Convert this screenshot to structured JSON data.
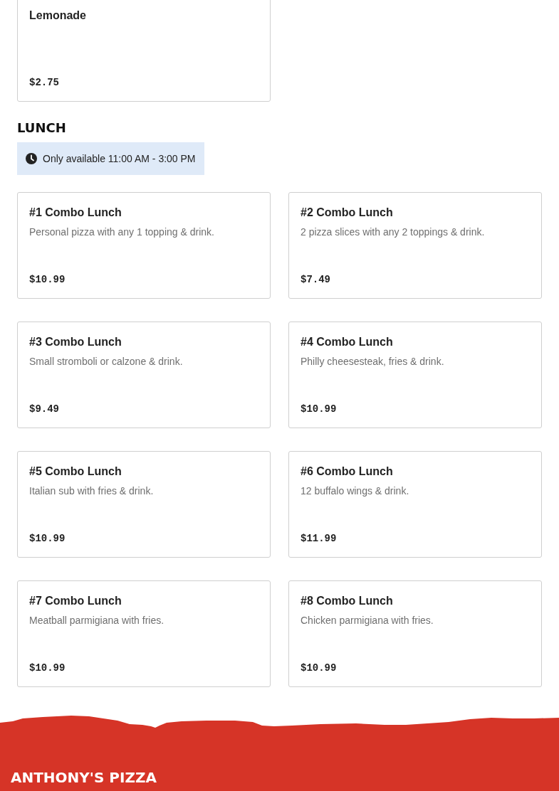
{
  "previous_section": {
    "items": [
      {
        "name": "Lemonade",
        "price": "$2.75"
      }
    ]
  },
  "section": {
    "title": "LUNCH",
    "availability": "Only available 11:00 AM - 3:00 PM",
    "items": [
      {
        "name": "#1 Combo Lunch",
        "description": "Personal pizza with any 1 topping & drink.",
        "price": "$10.99"
      },
      {
        "name": "#2 Combo Lunch",
        "description": "2 pizza slices with any 2 toppings & drink.",
        "price": "$7.49"
      },
      {
        "name": "#3 Combo Lunch",
        "description": "Small stromboli or calzone & drink.",
        "price": "$9.49"
      },
      {
        "name": "#4 Combo Lunch",
        "description": "Philly cheesesteak, fries & drink.",
        "price": "$10.99"
      },
      {
        "name": "#5 Combo Lunch",
        "description": "Italian sub with fries & drink.",
        "price": "$10.99"
      },
      {
        "name": "#6 Combo Lunch",
        "description": "12 buffalo wings & drink.",
        "price": "$11.99"
      },
      {
        "name": "#7 Combo Lunch",
        "description": "Meatball parmigiana with fries.",
        "price": "$10.99"
      },
      {
        "name": "#8 Combo Lunch",
        "description": "Chicken parmigiana with fries.",
        "price": "$10.99"
      }
    ]
  },
  "footer": {
    "brand": "ANTHONY'S PIZZA"
  }
}
